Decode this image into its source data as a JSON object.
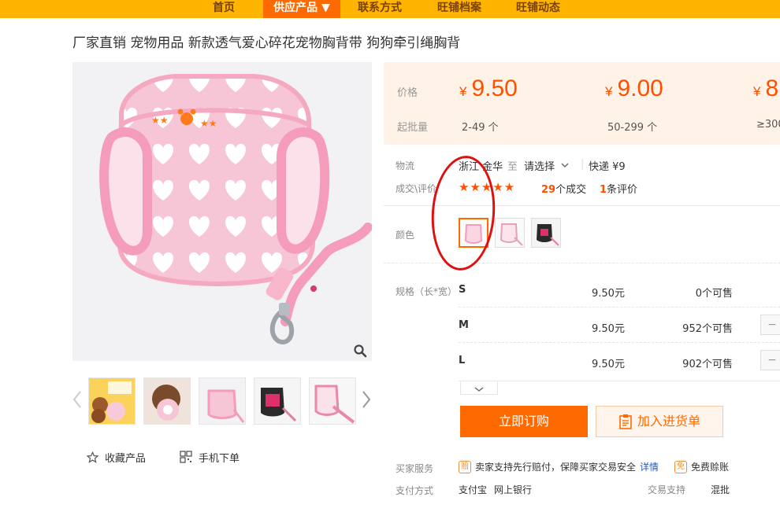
{
  "nav": {
    "home": "首页",
    "products": "供应产品 ▼",
    "contact": "联系方式",
    "archive": "旺铺档案",
    "news": "旺铺动态"
  },
  "product": {
    "title": "厂家直销 宠物用品 新款透气爱心碎花宠物胸背带 狗狗牵引绳胸背"
  },
  "gallery": {
    "actions": {
      "favorite": "收藏产品",
      "mobile": "手机下单"
    }
  },
  "pricing": {
    "price_label": "价格",
    "moq_label": "起批量",
    "currency": "¥",
    "tiers": [
      {
        "price": "9.50",
        "range": "2-49 个"
      },
      {
        "price": "9.00",
        "range": "50-299 个"
      },
      {
        "price": "8",
        "range": "≥300"
      }
    ]
  },
  "logistics": {
    "label": "物流",
    "from": "浙江 金华",
    "to_word": "至",
    "destination": "请选择",
    "express": "快递 ¥9"
  },
  "rating": {
    "label": "成交\\评价",
    "stars": "★★★★★",
    "deals_num": "29",
    "deals_text": "个成交",
    "reviews_num": "1",
    "reviews_text": "条评价"
  },
  "color": {
    "label": "颜色"
  },
  "sizes": {
    "label": "规格（长*宽）",
    "rows": [
      {
        "name": "S",
        "price": "9.50元",
        "stock": "0个可售"
      },
      {
        "name": "M",
        "price": "9.50元",
        "stock": "952个可售"
      },
      {
        "name": "L",
        "price": "9.50元",
        "stock": "902个可售"
      }
    ],
    "minus": "−"
  },
  "buttons": {
    "buy": "立即订购",
    "cart": "加入进货单"
  },
  "services": {
    "buyer_label": "买家服务",
    "guarantee": "卖家支持先行赔付，保障买家交易安全",
    "guarantee_badge": "赔",
    "details": "详情",
    "free_badge": "免",
    "free_text": "免费赊账",
    "pay_label": "支付方式",
    "pay_methods": [
      "支付宝",
      "网上银行"
    ],
    "trade_label": "交易支持",
    "trade_value": "混批"
  },
  "colors": {
    "accent": "#ff6a00",
    "price": "#ff5000",
    "nav": "#ffb400",
    "annotation": "#e01010"
  }
}
